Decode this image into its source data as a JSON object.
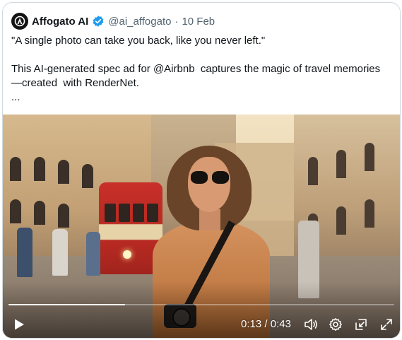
{
  "post": {
    "author_name": "Affogato AI",
    "handle": "@ai_affogato",
    "separator": "·",
    "date": "10 Feb",
    "lines": [
      "\"A single photo can take you back, like you never left.\"",
      "",
      "This AI-generated spec ad for @Airbnb  captures the magic of travel memories",
      "—created  with RenderNet.",
      "..."
    ]
  },
  "video": {
    "current_time": "0:13",
    "time_separator": "/",
    "duration": "0:43",
    "progress": 0.302
  },
  "icons": {
    "avatar": "affogato-logo-icon",
    "verified": "verified-badge-icon",
    "play": "play-icon",
    "volume": "volume-icon",
    "settings": "settings-gear-icon",
    "dock": "picture-in-picture-icon",
    "fullscreen": "fullscreen-icon"
  },
  "colors": {
    "verified_blue": "#1d9bf0",
    "text_primary": "#0f1419",
    "text_secondary": "#536471",
    "border": "#cfd9de"
  }
}
